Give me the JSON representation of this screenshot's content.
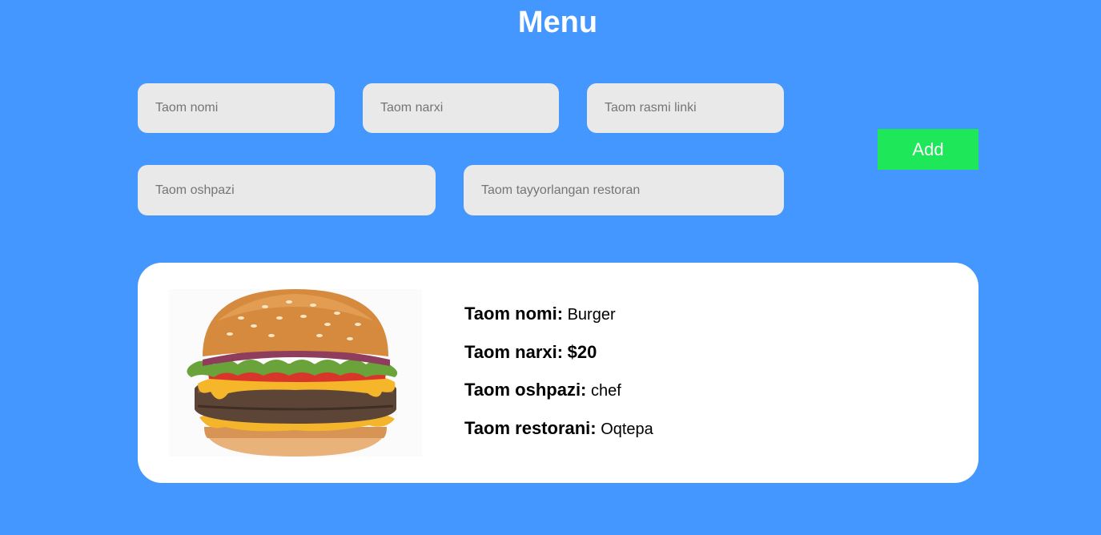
{
  "page": {
    "title": "Menu"
  },
  "form": {
    "name_placeholder": "Taom nomi",
    "price_placeholder": "Taom narxi",
    "image_placeholder": "Taom rasmi linki",
    "chef_placeholder": "Taom oshpazi",
    "restaurant_placeholder": "Taom tayyorlangan restoran",
    "add_label": "Add"
  },
  "card": {
    "image_alt": "burger-image",
    "rows": [
      {
        "label": "Taom nomi:",
        "value": "Burger"
      },
      {
        "label": "Taom narxi:",
        "value": "$20"
      },
      {
        "label": "Taom oshpazi:",
        "value": "chef"
      },
      {
        "label": "Taom restorani:",
        "value": "Oqtepa"
      }
    ]
  },
  "colors": {
    "background": "#4397fe",
    "input": "#e9e9e9",
    "add_button": "#1ee85a",
    "card": "#ffffff"
  }
}
